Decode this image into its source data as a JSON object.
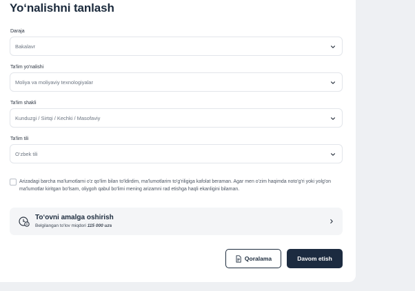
{
  "page": {
    "title": "Yo‘nalishni tanlash"
  },
  "fields": [
    {
      "label": "Daraja",
      "value": "Bakalavr"
    },
    {
      "label": "Ta'lim yo'nalishi",
      "value": "Moliya va moliyaviy texnologiyalar"
    },
    {
      "label": "Ta'lim shakli",
      "value": "Kunduzgi / Sirtqi / Kechki / Masofaviy"
    },
    {
      "label": "Ta'lim tili",
      "value": "O‘zbek tili"
    }
  ],
  "consent": {
    "checked": false,
    "text": "Arizadagi barcha ma'lumotlarni o'z qo'lim bilan to'ldirdim, ma'lumotlarim to'g'riligiga kafolat beraman. Agar men o'zim haqimda noto'g'ri yoki yolg'on ma'lumotlar kiritgan bo'lsam, oliygoh qabul bo'limi mening arizamni rad etishga haqli ekanligini bilaman."
  },
  "payment": {
    "title": "To‘ovni amalga oshirish",
    "subtitle_prefix": "Belgilangan to'lov miqdori",
    "amount": "115 000 uzs",
    "icon": "money-clock-icon"
  },
  "buttons": {
    "draft_label": "Qoralama",
    "next_label": "Davom etish"
  },
  "colors": {
    "primary": "#1c2b40",
    "border": "#e2e5ea",
    "background": "#eef0f3",
    "panel": "#f4f5f7"
  }
}
